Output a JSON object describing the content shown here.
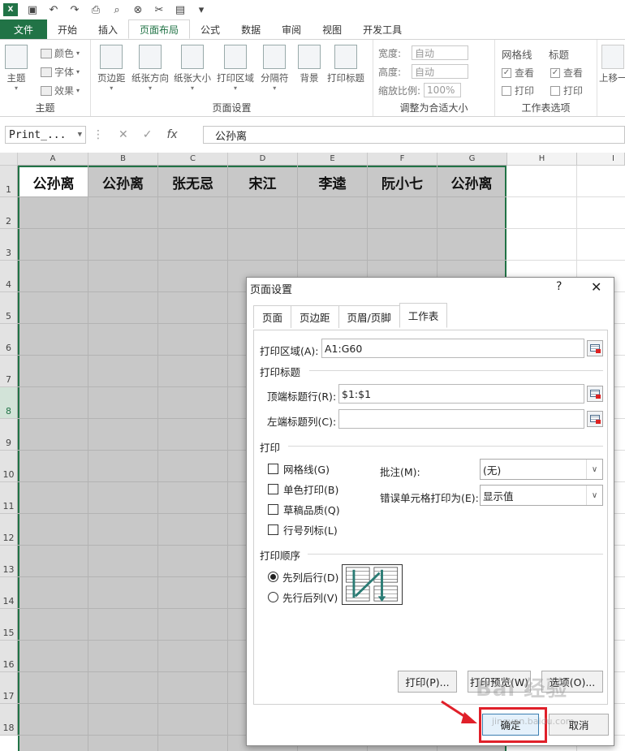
{
  "ribbon_tabs": [
    "文件",
    "开始",
    "插入",
    "页面布局",
    "公式",
    "数据",
    "审阅",
    "视图",
    "开发工具"
  ],
  "ribbon": {
    "theme": {
      "main": "主题",
      "colors": "颜色",
      "fonts": "字体",
      "effects": "效果",
      "group": "主题"
    },
    "pagesetup": {
      "margins": "页边距",
      "orientation": "纸张方向",
      "size": "纸张大小",
      "printarea": "打印区域",
      "breaks": "分隔符",
      "background": "背景",
      "printtitles": "打印标题",
      "group": "页面设置"
    },
    "scale": {
      "width": "宽度:",
      "height": "高度:",
      "scale": "缩放比例:",
      "width_val": "自动",
      "height_val": "自动",
      "scale_val": "100%",
      "group": "调整为合适大小"
    },
    "sheetopts": {
      "gridlines": "网格线",
      "headings": "标题",
      "view": "查看",
      "print": "打印",
      "group": "工作表选项",
      "arrange": "上移一"
    }
  },
  "namebox": "Print_...",
  "formula": "公孙离",
  "columns": [
    "A",
    "B",
    "C",
    "D",
    "E",
    "F",
    "G",
    "H",
    "I"
  ],
  "rows": [
    "1",
    "2",
    "3",
    "4",
    "5",
    "6",
    "7",
    "8",
    "9",
    "10",
    "11",
    "12",
    "13",
    "14",
    "15",
    "16",
    "17",
    "18"
  ],
  "header_cells": [
    "公孙离",
    "公孙离",
    "张无忌",
    "宋江",
    "李逵",
    "阮小七",
    "公孙离"
  ],
  "dialog": {
    "title": "页面设置",
    "help": "?",
    "close": "✕",
    "tabs": [
      "页面",
      "页边距",
      "页眉/页脚",
      "工作表"
    ],
    "print_area_label": "打印区域(A):",
    "print_area": "A1:G60",
    "print_titles": "打印标题",
    "top_rows_label": "顶端标题行(R):",
    "top_rows": "$1:$1",
    "left_cols_label": "左端标题列(C):",
    "left_cols": "",
    "print_section": "打印",
    "opts": [
      "网格线(G)",
      "单色打印(B)",
      "草稿品质(Q)",
      "行号列标(L)"
    ],
    "comments_label": "批注(M):",
    "comments": "(无)",
    "errors_label": "错误单元格打印为(E):",
    "errors": "显示值",
    "order_section": "打印顺序",
    "order_opts": [
      "先列后行(D)",
      "先行后列(V)"
    ],
    "btn_print": "打印(P)...",
    "btn_preview": "打印预览(W)",
    "btn_options": "选项(O)...",
    "btn_ok": "确定",
    "btn_cancel": "取消"
  },
  "watermark": "Bai 经验",
  "watermark_url": "jingyan.baidu.com"
}
